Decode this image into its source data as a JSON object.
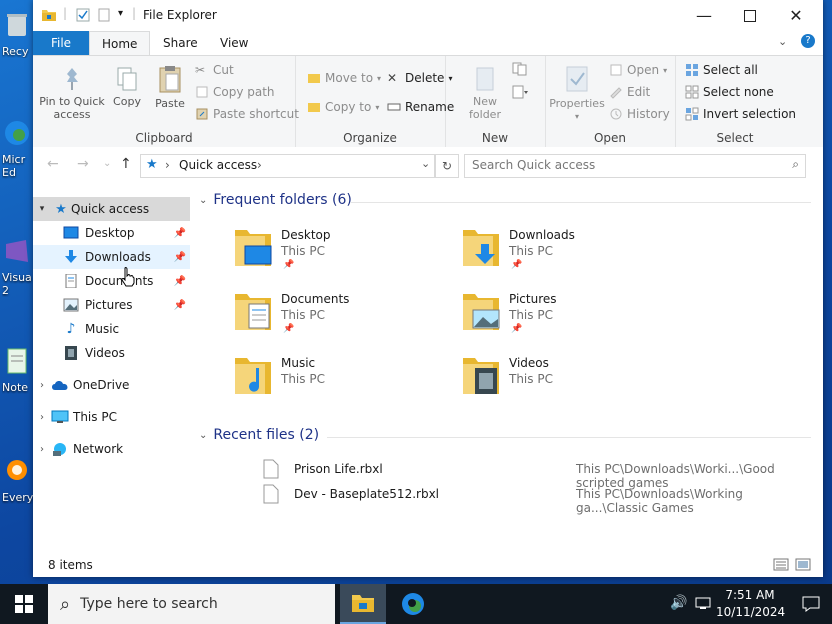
{
  "desktop": {
    "icons": [
      {
        "label": "Recy"
      },
      {
        "label": "Micr\nEd"
      },
      {
        "label": "Visua\n2"
      },
      {
        "label": "Note"
      },
      {
        "label": "Every"
      }
    ]
  },
  "window": {
    "title": "File Explorer",
    "menu_tabs": {
      "file": "File",
      "home": "Home",
      "share": "Share",
      "view": "View"
    },
    "ribbon": {
      "clipboard": {
        "label": "Clipboard",
        "pin": "Pin to Quick\naccess",
        "copy": "Copy",
        "paste": "Paste",
        "cut": "Cut",
        "copy_path": "Copy path",
        "paste_shortcut": "Paste shortcut"
      },
      "organize": {
        "label": "Organize",
        "move_to": "Move to",
        "copy_to": "Copy to",
        "delete": "Delete",
        "rename": "Rename"
      },
      "new": {
        "label": "New",
        "new_folder": "New\nfolder"
      },
      "open": {
        "label": "Open",
        "properties": "Properties",
        "open": "Open",
        "edit": "Edit",
        "history": "History"
      },
      "select": {
        "label": "Select",
        "select_all": "Select all",
        "select_none": "Select none",
        "invert": "Invert selection"
      }
    },
    "address": {
      "path": "Quick access",
      "search_placeholder": "Search Quick access"
    },
    "sidebar": {
      "quick_access": "Quick access",
      "items": [
        "Desktop",
        "Downloads",
        "Documents",
        "Pictures",
        "Music",
        "Videos"
      ],
      "onedrive": "OneDrive",
      "this_pc": "This PC",
      "network": "Network"
    },
    "frequent": {
      "header": "Frequent folders (6)",
      "folders": [
        {
          "name": "Desktop",
          "location": "This PC"
        },
        {
          "name": "Downloads",
          "location": "This PC"
        },
        {
          "name": "Documents",
          "location": "This PC"
        },
        {
          "name": "Pictures",
          "location": "This PC"
        },
        {
          "name": "Music",
          "location": "This PC"
        },
        {
          "name": "Videos",
          "location": "This PC"
        }
      ]
    },
    "recent": {
      "header": "Recent files (2)",
      "files": [
        {
          "name": "Prison Life.rbxl",
          "path": "This PC\\Downloads\\Worki...\\Good scripted games"
        },
        {
          "name": "Dev - Baseplate512.rbxl",
          "path": "This PC\\Downloads\\Working ga...\\Classic Games"
        }
      ]
    },
    "status": {
      "items": "8 items"
    }
  },
  "taskbar": {
    "search_placeholder": "Type here to search",
    "time": "7:51 AM",
    "date": "10/11/2024"
  },
  "colors": {
    "accent": "#1979ca",
    "taskbar": "#101820",
    "section_header": "#1e3287"
  }
}
